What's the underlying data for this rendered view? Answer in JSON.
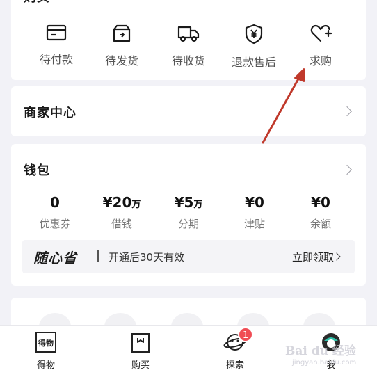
{
  "orders": {
    "title": "购买",
    "items": [
      {
        "label": "待付款",
        "icon": "card-icon"
      },
      {
        "label": "待发货",
        "icon": "box-icon"
      },
      {
        "label": "待收货",
        "icon": "truck-icon"
      },
      {
        "label": "退款售后",
        "icon": "shield-yen-icon"
      },
      {
        "label": "求购",
        "icon": "heart-plus-icon"
      }
    ]
  },
  "merchant": {
    "title": "商家中心"
  },
  "wallet": {
    "title": "钱包",
    "items": [
      {
        "value": "0",
        "unit": "",
        "label": "优惠券"
      },
      {
        "value": "¥20",
        "unit": "万",
        "label": "借钱"
      },
      {
        "value": "¥5",
        "unit": "万",
        "label": "分期"
      },
      {
        "value": "¥0",
        "unit": "",
        "label": "津贴"
      },
      {
        "value": "¥0",
        "unit": "",
        "label": "余额"
      }
    ],
    "promo": {
      "logo": "随心省",
      "desc": "开通后30天有效",
      "link": "立即领取"
    }
  },
  "tabbar": {
    "items": [
      {
        "label": "得物",
        "icon": "dewu-logo-icon"
      },
      {
        "label": "购买",
        "icon": "shopping-bag-icon"
      },
      {
        "label": "探索",
        "icon": "planet-icon",
        "badge": "1"
      },
      {
        "label": "我",
        "icon": "avatar-icon"
      }
    ]
  },
  "watermark": {
    "text": "Bai du 经验",
    "sub": "jingyan.baidu.com"
  },
  "colors": {
    "badge": "#f04c54",
    "arrow": "#c0392b",
    "background": "#f2f2f7"
  }
}
